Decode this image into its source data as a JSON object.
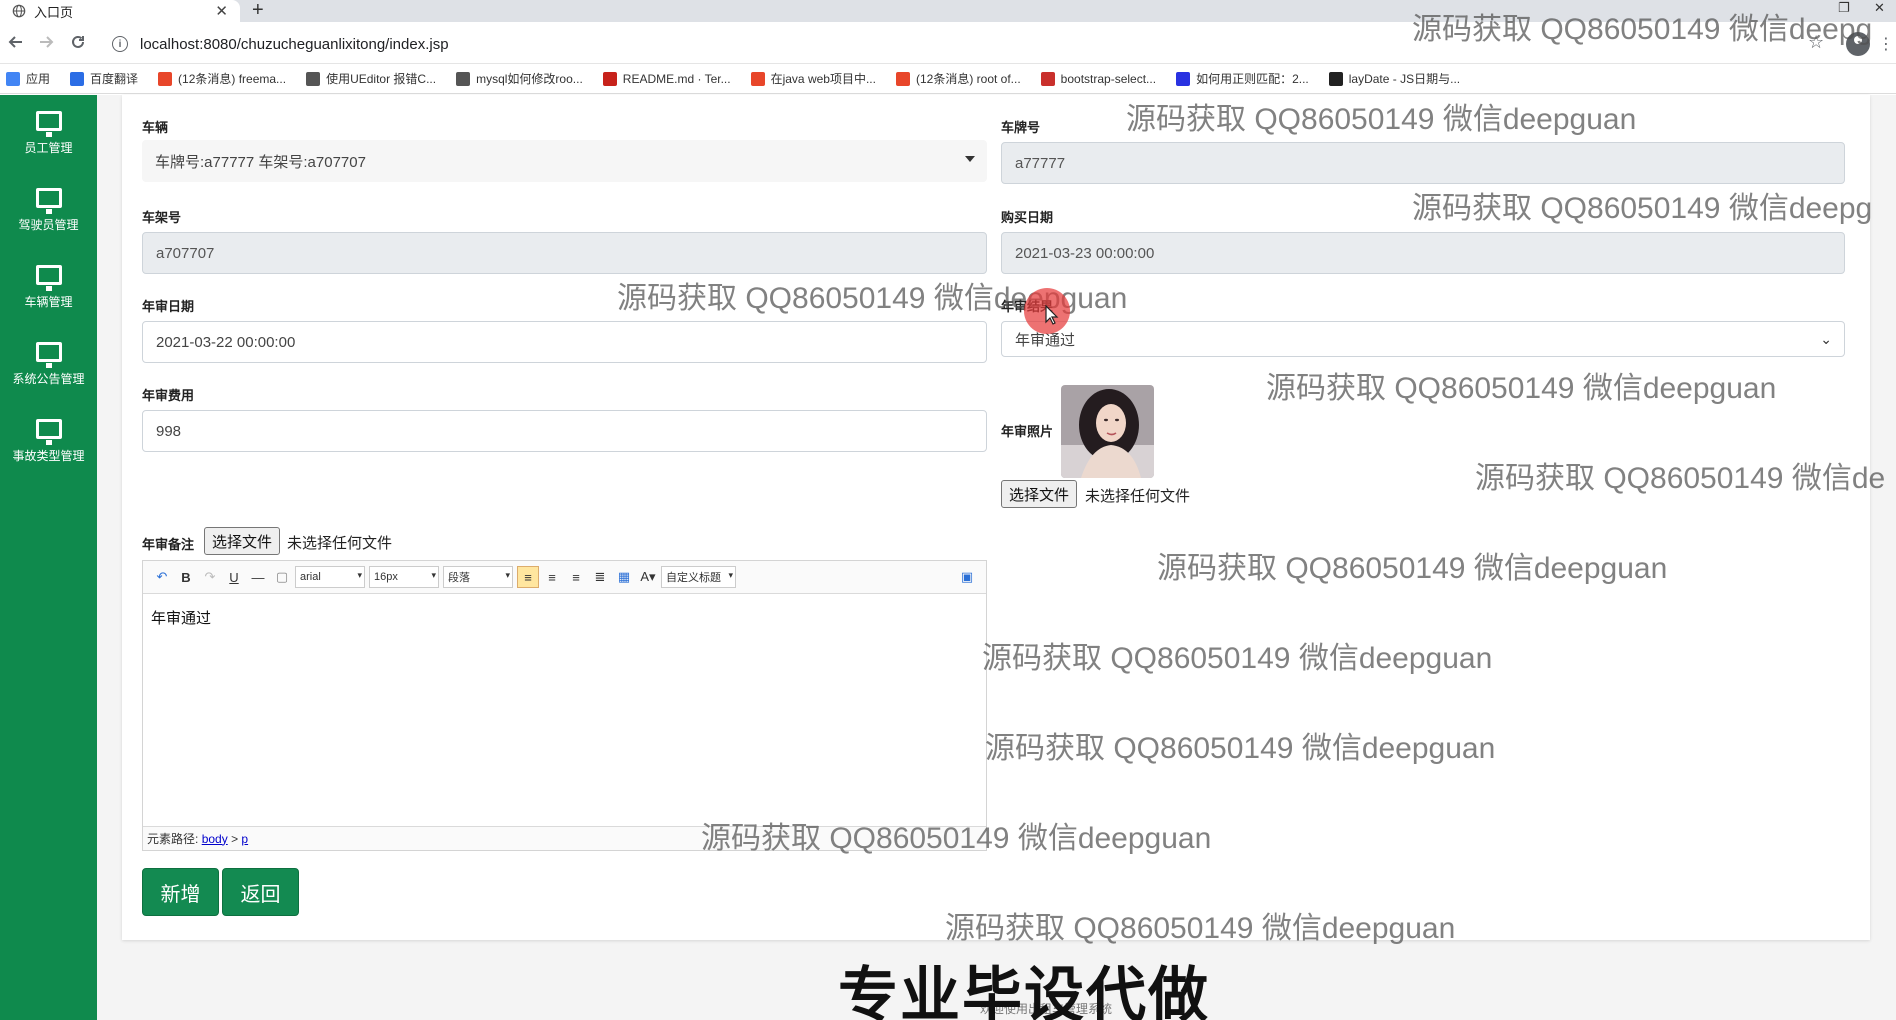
{
  "browser": {
    "tab_title": "入口页",
    "url": "localhost:8080/chuzucheguanlixitong/index.jsp",
    "bookmarks": [
      {
        "label": "应用",
        "color": "#4285f4"
      },
      {
        "label": "百度翻译",
        "color": "#2b6de5"
      },
      {
        "label": "(12条消息) freema...",
        "color": "#e8462a"
      },
      {
        "label": "使用UEditor 报错C...",
        "color": "#555555"
      },
      {
        "label": "mysql如何修改roo...",
        "color": "#555555"
      },
      {
        "label": "README.md · Ter...",
        "color": "#c7221b"
      },
      {
        "label": "在java web项目中...",
        "color": "#e8462a"
      },
      {
        "label": "(12条消息) root of...",
        "color": "#e8462a"
      },
      {
        "label": "bootstrap-select...",
        "color": "#c9302c"
      },
      {
        "label": "如何用正则匹配：2...",
        "color": "#2932e1"
      },
      {
        "label": "layDate - JS日期与...",
        "color": "#222222"
      }
    ]
  },
  "sidebar": {
    "items": [
      {
        "label": "员工管理"
      },
      {
        "label": "驾驶员管理"
      },
      {
        "label": "车辆管理"
      },
      {
        "label": "系统公告管理"
      },
      {
        "label": "事故类型管理"
      }
    ]
  },
  "form": {
    "vehicle_label": "车辆",
    "vehicle_value": "车牌号:a77777 车架号:a707707",
    "plate_label": "车牌号",
    "plate_value": "a77777",
    "frame_label": "车架号",
    "frame_value": "a707707",
    "purchase_label": "购买日期",
    "purchase_value": "2021-03-23 00:00:00",
    "inspect_date_label": "年审日期",
    "inspect_date_value": "2021-03-22 00:00:00",
    "inspect_result_label": "年审结果",
    "inspect_result_value": "年审通过",
    "inspect_fee_label": "年审费用",
    "inspect_fee_value": "998",
    "inspect_photo_label": "年审照片",
    "choose_file": "选择文件",
    "no_file": "未选择任何文件",
    "remark_label": "年审备注",
    "editor": {
      "font": "arial",
      "size": "16px",
      "paragraph": "段落",
      "custom_title": "自定义标题",
      "content": "年审通过",
      "path_label": "元素路径:",
      "path_body": "body",
      "path_sep": ">",
      "path_p": "p"
    },
    "add_button": "新增",
    "back_button": "返回"
  },
  "watermarks": {
    "text": "源码获取 QQ86050149 微信deepguan",
    "text_cut1": "源码获取 QQ86050149 微信deepg",
    "text_cut2": "源码获取 QQ86050149 微信de"
  },
  "footer": {
    "big": "专业毕设代做",
    "small": "欢迎使用出租车管理系统"
  }
}
